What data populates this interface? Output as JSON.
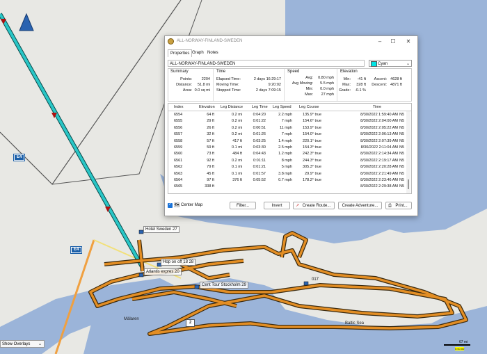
{
  "map": {
    "labels": {
      "road": "E4",
      "road2": "E4",
      "maelaren": "Mälaren",
      "baltic": "Baltic Sea",
      "road_number": "2"
    },
    "waypoints": [
      {
        "name": "Hotel Sweden 27"
      },
      {
        "name": "Hop on off 18 28"
      },
      {
        "name": "Atlantis expres 20"
      },
      {
        "name": "Cent Tour Stockholm 29"
      },
      {
        "name": "017"
      }
    ],
    "overlay_select": "Show Overlays",
    "scale": {
      "label": "67 mi",
      "sub": "0:00:00"
    }
  },
  "window": {
    "title": "ALL-NORWAY-FINLAND-SWEDEN",
    "tabs": [
      "Properties",
      "Graph",
      "Notes"
    ],
    "name": "ALL-NORWAY-FINLAND-SWEDEN",
    "color": "Cyan",
    "summary": {
      "header": "Summary",
      "points_label": "Points:",
      "points": "2204",
      "distance_label": "Distance:",
      "distance": "51.8 mi",
      "area_label": "Area:",
      "area": "0.0 sq mi"
    },
    "time": {
      "header": "Time",
      "elapsed_label": "Elapsed Time:",
      "elapsed": "2 days 16:29:17",
      "moving_label": "Moving Time:",
      "moving": "9:20:02",
      "stopped_label": "Stopped Time:",
      "stopped": "2 days 7:09:15"
    },
    "speed": {
      "header": "Speed",
      "avg_label": "Avg:",
      "avg": "0.80 mph",
      "avgmoving_label": "Avg Moving:",
      "avgmoving": "5.5 mph",
      "min_label": "Min:",
      "min": "0.0 mph",
      "max_label": "Max:",
      "max": "27 mph"
    },
    "elevation": {
      "header": "Elevation",
      "min_label": "Min:",
      "min": "-41 ft",
      "max_label": "Max:",
      "max": "328 ft",
      "grade_label": "Grade:",
      "grade": "-0.1 %",
      "ascent_label": "Ascent:",
      "ascent": "4628 ft",
      "descent_label": "Descent:",
      "descent": "4871 ft"
    },
    "columns": [
      "Index",
      "Elevation",
      "Leg Distance",
      "Leg Time",
      "Leg Speed",
      "Leg Course",
      "Time",
      ""
    ],
    "rows": [
      [
        "6554",
        "64 ft",
        "0.2 mi",
        "0:04:20",
        "2.2 mph",
        "135.9° true",
        "8/30/2022 1:59:40 AM",
        "N5"
      ],
      [
        "6555",
        "29 ft",
        "0.2 mi",
        "0:01:22",
        "7 mph",
        "154.6° true",
        "8/30/2022 2:04:00 AM",
        "N5"
      ],
      [
        "6556",
        "26 ft",
        "0.2 mi",
        "0:00:51",
        "11 mph",
        "153.9° true",
        "8/30/2022 2:05:22 AM",
        "N5"
      ],
      [
        "6557",
        "32 ft",
        "0.2 mi",
        "0:01:26",
        "7 mph",
        "154.0° true",
        "8/30/2022 2:06:13 AM",
        "N5"
      ],
      [
        "6558",
        "57 ft",
        "417 ft",
        "0:03:25",
        "1.4 mph",
        "220.1° true",
        "8/30/2022 2:07:39 AM",
        "N5"
      ],
      [
        "6559",
        "59 ft",
        "0.1 mi",
        "0:03:30",
        "2.5 mph",
        "154.3° true",
        "8/30/2022 2:11:04 AM",
        "N5"
      ],
      [
        "6560",
        "73 ft",
        "484 ft",
        "0:04:43",
        "1.2 mph",
        "242.3° true",
        "8/30/2022 2:14:34 AM",
        "N5"
      ],
      [
        "6561",
        "92 ft",
        "0.2 mi",
        "0:01:11",
        "8 mph",
        "244.3° true",
        "8/30/2022 2:19:17 AM",
        "N5"
      ],
      [
        "6562",
        "79 ft",
        "0.1 mi",
        "0:01:21",
        "5 mph",
        "305.3° true",
        "8/30/2022 2:20:28 AM",
        "N5"
      ],
      [
        "6563",
        "45 ft",
        "0.1 mi",
        "0:01:57",
        "3.8 mph",
        "29.9° true",
        "8/30/2022 2:21:49 AM",
        "N5"
      ],
      [
        "6564",
        "97 ft",
        "376 ft",
        "0:05:52",
        "0.7 mph",
        "178.2° true",
        "8/30/2022 2:23:46 AM",
        "N5"
      ],
      [
        "6565",
        "338 ft",
        "",
        "",
        "",
        "",
        "8/30/2022 2:29:38 AM",
        "N5"
      ]
    ],
    "footer": {
      "center_map": "Center Map",
      "filter": "Filter...",
      "invert": "Invert",
      "create_route": "Create Route...",
      "create_adventure": "Create Adventure...",
      "print": "Print..."
    }
  },
  "colors": {
    "track": "#d98a1f",
    "track_outline": "#3a2a10",
    "cyan_line": "#29c6c6",
    "water": "#9bb4d9",
    "land": "#e8e8e4"
  }
}
